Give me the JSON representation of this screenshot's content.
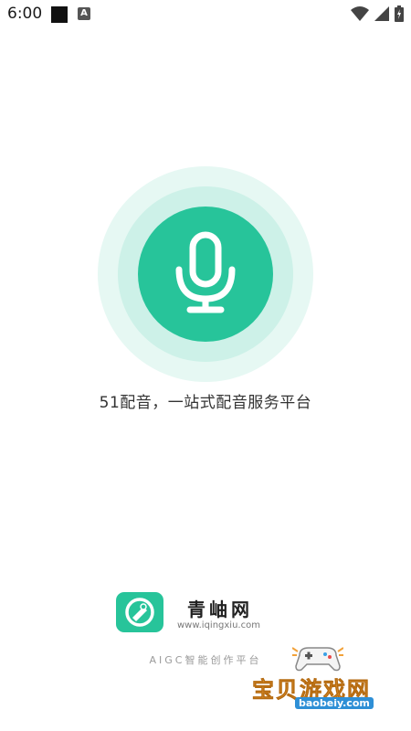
{
  "status_bar": {
    "time": "6:00",
    "notif_a": "A"
  },
  "splash": {
    "tagline": "51配音，一站式配音服务平台",
    "accent": "#27c49a",
    "ring_inner": "#cdf1e8",
    "ring_outer": "#e6f8f3"
  },
  "brand": {
    "name": "青岫网",
    "url": "www.iqingxiu.com",
    "slogan": "AIGC智能创作平台"
  },
  "watermark": {
    "text": "宝贝游戏网",
    "url": "baobeiy.com"
  },
  "icons": [
    "microphone-icon",
    "wifi-icon",
    "signal-icon",
    "battery-icon",
    "gamepad-icon"
  ]
}
